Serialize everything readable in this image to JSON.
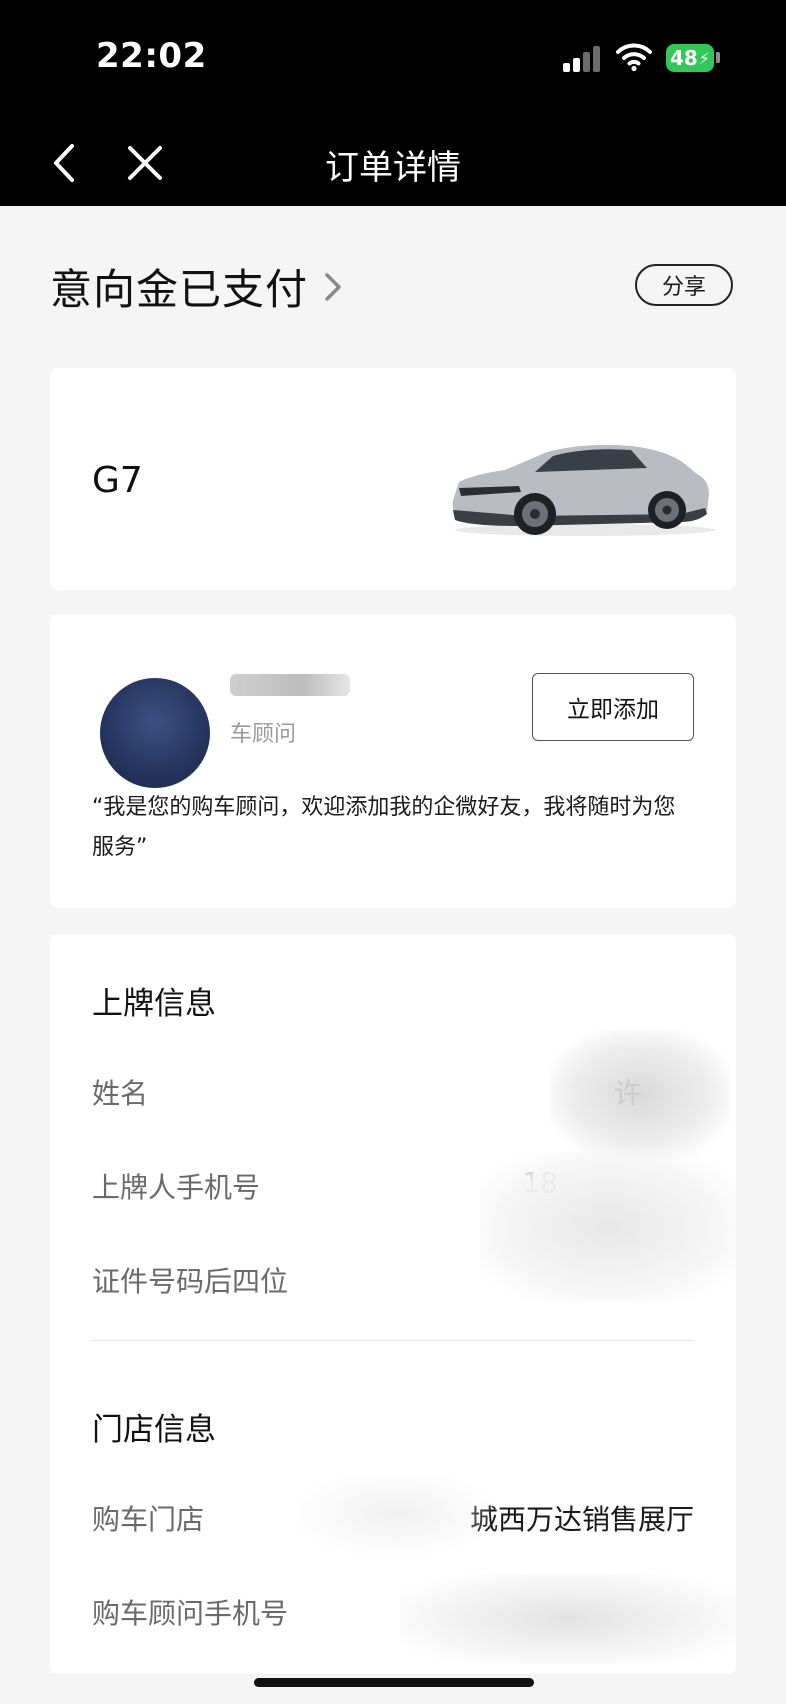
{
  "status_bar": {
    "time": "22:02",
    "battery": "48"
  },
  "nav": {
    "title": "订单详情"
  },
  "order": {
    "status": "意向金已支付",
    "share_label": "分享"
  },
  "car": {
    "model": "G7",
    "image_icon": "car-image"
  },
  "advisor": {
    "role": "车顾问",
    "add_label": "立即添加",
    "quote": "“我是您的购车顾问，欢迎添加我的企微好友，我将随时为您服务”"
  },
  "plate_info": {
    "title": "上牌信息",
    "rows": [
      {
        "label": "姓名",
        "value": "许"
      },
      {
        "label": "上牌人手机号",
        "value": "18"
      },
      {
        "label": "证件号码后四位",
        "value": ""
      }
    ]
  },
  "store_info": {
    "title": "门店信息",
    "rows": [
      {
        "label": "购车门店",
        "value": "城西万达销售展厅"
      },
      {
        "label": "购车顾问手机号",
        "value": ""
      }
    ]
  },
  "colors": {
    "battery": "#32c759",
    "background": "#f5f5f5",
    "topbar": "#000000"
  }
}
